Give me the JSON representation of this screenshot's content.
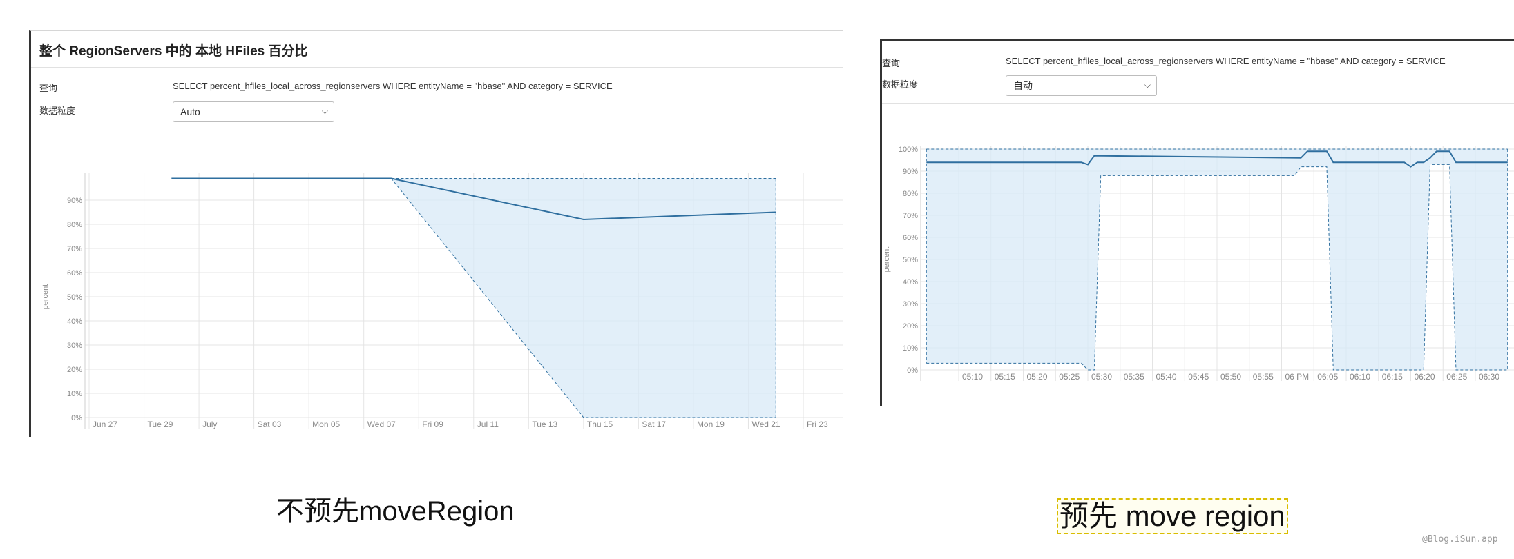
{
  "left_panel": {
    "title": "整个 RegionServers 中的 本地 HFiles 百分比",
    "query_label": "查询",
    "query_text": "SELECT percent_hfiles_local_across_regionservers WHERE entityName = \"hbase\" AND category = SERVICE",
    "granularity_label": "数据粒度",
    "granularity_value": "Auto"
  },
  "right_panel": {
    "query_label": "查询",
    "query_text": "SELECT percent_hfiles_local_across_regionservers WHERE entityName = \"hbase\" AND category = SERVICE",
    "granularity_label": "数据粒度",
    "granularity_value": "自动"
  },
  "captions": {
    "left": "不预先moveRegion",
    "right": "预先 move region"
  },
  "watermark": "@Blog.iSun.app",
  "colors": {
    "line": "#2f6f9f",
    "band_fill": "#d8eaf7",
    "grid": "#e4e4e4",
    "axis_text": "#888888"
  },
  "chart_data": [
    {
      "type": "area",
      "ylabel": "percent",
      "ylim": [
        0,
        100
      ],
      "x_tick_labels": [
        "Jun 27",
        "Tue 29",
        "July",
        "Sat 03",
        "Mon 05",
        "Wed 07",
        "Fri 09",
        "Jul 11",
        "Tue 13",
        "Thu 15",
        "Sat 17",
        "Mon 19",
        "Wed 21",
        "Fri 23"
      ],
      "y_tick_labels": [
        "0%",
        "10%",
        "20%",
        "30%",
        "40%",
        "50%",
        "60%",
        "70%",
        "80%",
        "90%"
      ],
      "grid": true,
      "series": [
        {
          "role": "mean",
          "x": [
            "2021-06-29T24:00",
            "2021-07-08T00:00",
            "2021-07-15T00:00",
            "2021-07-22T00:00"
          ],
          "values": [
            99,
            99,
            82,
            85
          ]
        },
        {
          "role": "band",
          "x": [
            "2021-07-08T00:00",
            "2021-07-15T00:00",
            "2021-07-22T00:00"
          ],
          "max": [
            99,
            99,
            99
          ],
          "min": [
            99,
            0,
            0
          ]
        }
      ]
    },
    {
      "type": "area",
      "ylabel": "percent",
      "ylim": [
        0,
        100
      ],
      "x_tick_labels": [
        "05:10",
        "05:15",
        "05:20",
        "05:25",
        "05:30",
        "05:35",
        "05:40",
        "05:45",
        "05:50",
        "05:55",
        "06 PM",
        "06:05",
        "06:10",
        "06:15",
        "06:20",
        "06:25",
        "06:30"
      ],
      "y_tick_labels": [
        "0%",
        "10%",
        "20%",
        "30%",
        "40%",
        "50%",
        "60%",
        "70%",
        "80%",
        "90%",
        "100%"
      ],
      "grid": true,
      "series": [
        {
          "role": "mean",
          "x": [
            "05:05",
            "05:29",
            "05:30",
            "05:31",
            "06:03",
            "06:04",
            "06:07",
            "06:08",
            "06:19",
            "06:20",
            "06:21",
            "06:22",
            "06:23",
            "06:24",
            "06:26",
            "06:27",
            "06:35"
          ],
          "values": [
            94,
            94,
            93,
            97,
            96,
            99,
            99,
            94,
            94,
            92,
            94,
            94,
            96,
            99,
            99,
            94,
            94
          ]
        },
        {
          "role": "band",
          "x": [
            "05:05",
            "05:29",
            "05:30",
            "05:31",
            "05:32",
            "06:02",
            "06:03",
            "06:07",
            "06:08",
            "06:22",
            "06:23",
            "06:26",
            "06:27",
            "06:35"
          ],
          "max": [
            100,
            100,
            100,
            100,
            100,
            100,
            100,
            100,
            100,
            100,
            100,
            100,
            100,
            100
          ],
          "min": [
            3,
            3,
            0,
            0,
            88,
            88,
            92,
            92,
            0,
            0,
            93,
            93,
            0,
            0
          ]
        }
      ]
    }
  ]
}
